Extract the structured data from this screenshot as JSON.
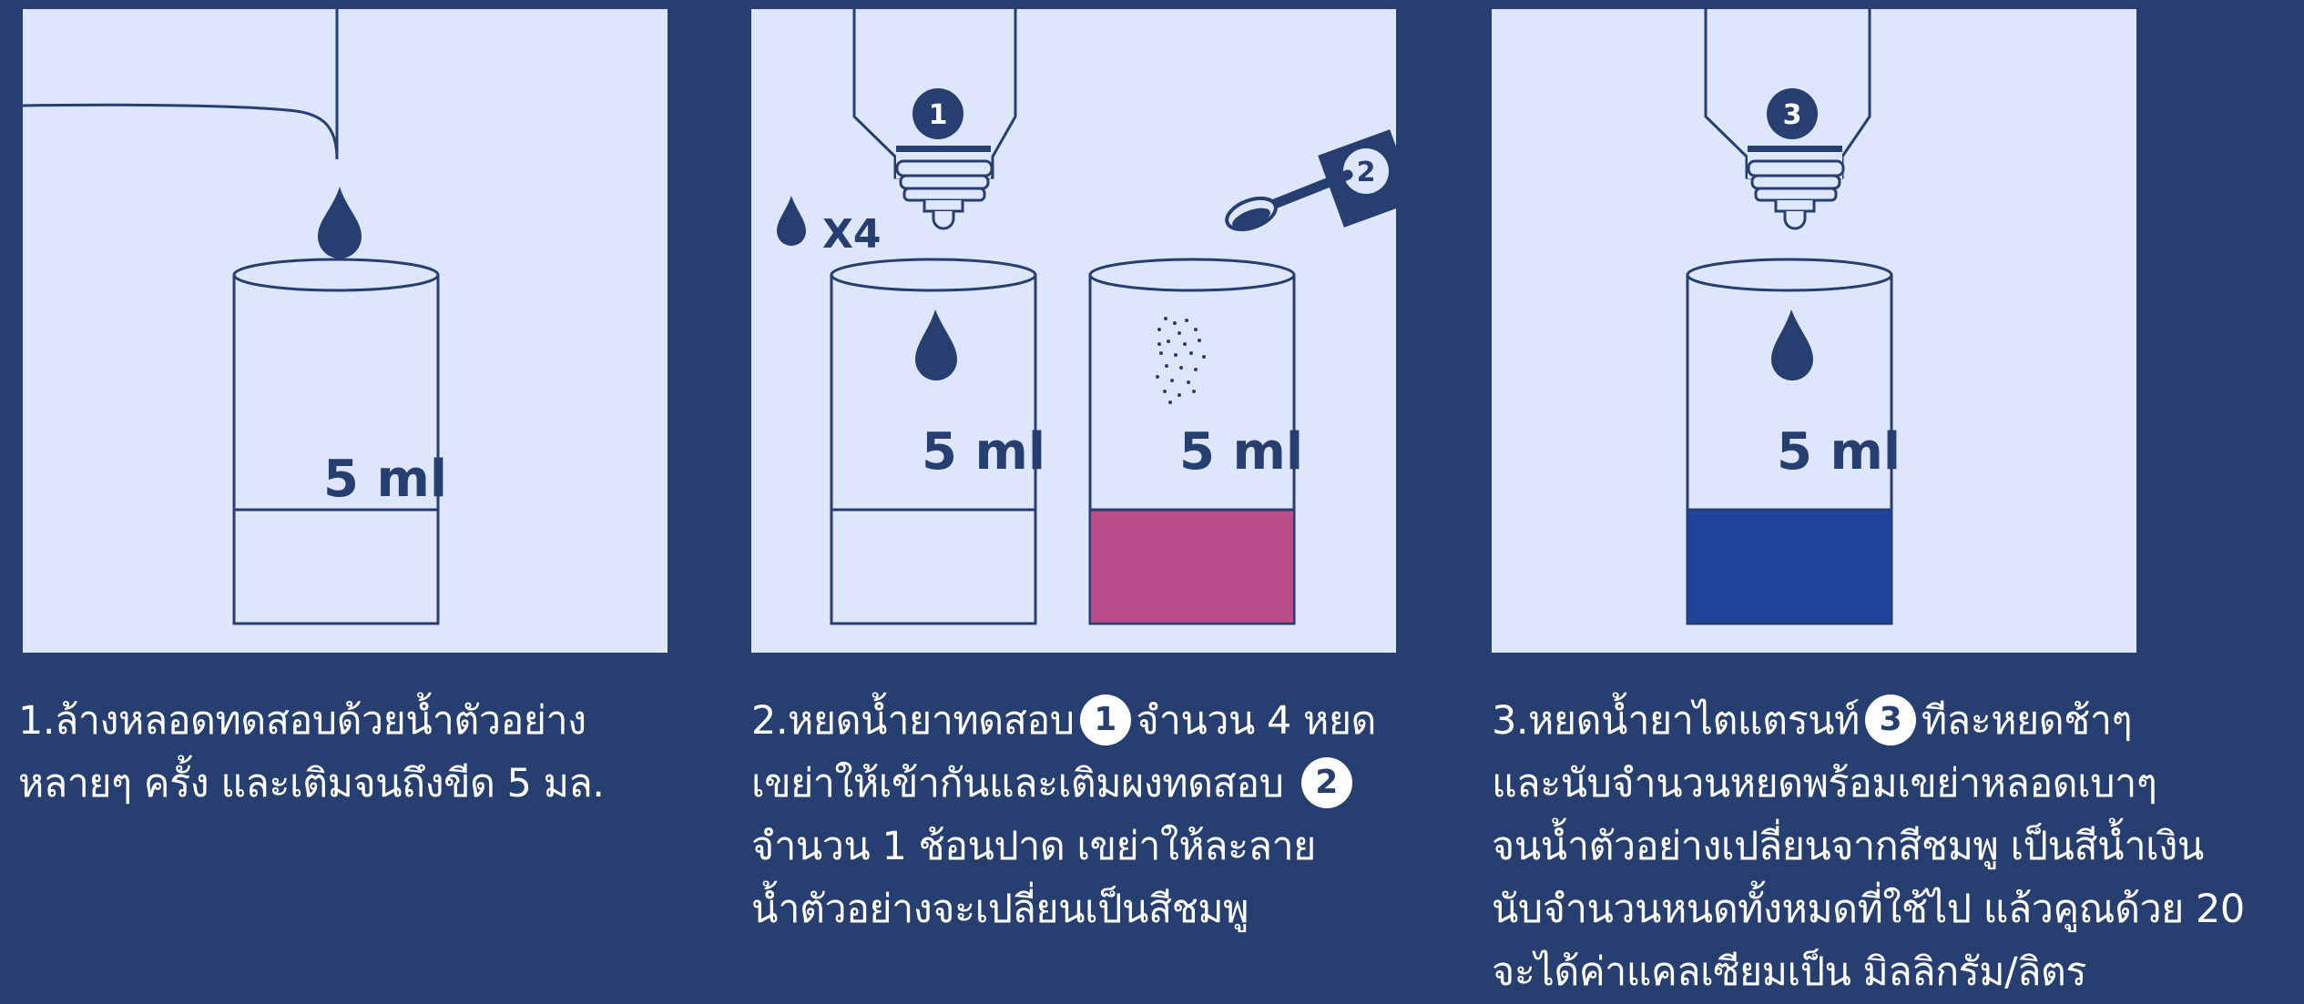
{
  "colors": {
    "background": "#263e70",
    "panel": "#dde6fb",
    "outline": "#263e70",
    "pink_liquid": "#b84d8a",
    "blue_liquid": "#21449b"
  },
  "steps": [
    {
      "volume_label": "5 ml",
      "caption_lines": [
        "1.ล้างหลอดทดสอบด้วยน้ำตัวอย่าง",
        "หลายๆ ครั้ง และเติมจนถึงขีด 5 มล."
      ]
    },
    {
      "reagent_badge": "1",
      "powder_badge": "2",
      "drop_count_label": "X4",
      "volume_label_left": "5 ml",
      "volume_label_right": "5 ml",
      "caption": {
        "l1_a": "2.หยดน้ำยาทดสอบ",
        "l1_badge": "1",
        "l1_b": "จำนวน 4 หยด",
        "l2_a": "เขย่าให้เข้ากันและเติมผงทดสอบ",
        "l2_badge": "2",
        "l3": "จำนวน 1 ช้อนปาด เขย่าให้ละลาย",
        "l4": "น้ำตัวอย่างจะเปลี่ยนเป็นสีชมพู"
      }
    },
    {
      "reagent_badge": "3",
      "volume_label": "5 ml",
      "caption": {
        "l1_a": "3.หยดน้ำยาไตแตรนท์",
        "l1_badge": "3",
        "l1_b": "ทีละหยดช้าๆ",
        "l2": "และนับจำนวนหยดพร้อมเขย่าหลอดเบาๆ",
        "l3": "จนน้ำตัวอย่างเปลี่ยนจากสีชมพู เป็นสีน้ำเงิน",
        "l4": "นับจำนวนหนดทั้งหมดที่ใช้ไป แล้วคูณด้วย 20",
        "l5": "จะได้ค่าแคลเซียมเป็น มิลลิกรัม/ลิตร"
      }
    }
  ]
}
